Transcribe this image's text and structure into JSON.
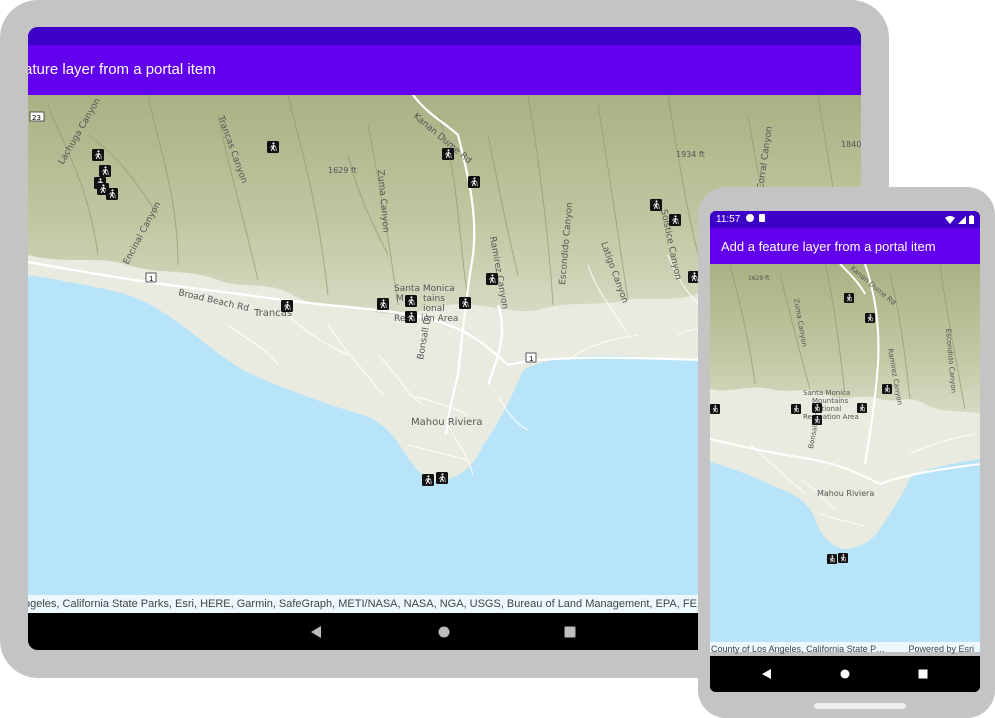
{
  "app": {
    "title": "Add a feature layer from a portal item",
    "tablet_title_visible": "ature layer from a portal item"
  },
  "status_bar": {
    "time": "11:57"
  },
  "map": {
    "labels": {
      "trancas": "Trancas",
      "mahou_riviera": "Mahou Riviera",
      "santa_monica_line1": "Santa Monica",
      "santa_monica_line2": "Mountains",
      "santa_monica_line3": "National",
      "santa_monica_line4": "Recreation Area",
      "tablet_sm_line2": "M",
      "tablet_sm_line2b": "tains",
      "tablet_sm_line3": "ional",
      "tablet_sm_line4": "Rec",
      "tablet_sm_line4b": "ion Area",
      "broad_beach_rd": "Broad Beach Rd",
      "bonsall_dr": "Bonsall Dr",
      "lachuga_canyon": "Lachuga Canyon",
      "encinal_canyon": "Encinal Canyon",
      "trancas_canyon": "Trancas Canyon",
      "zuma_canyon": "Zuma Canyon",
      "ramirez_canyon": "Ramirez Canyon",
      "escondido_canyon": "Escondido Canyon",
      "latigo_canyon": "Latigo Canyon",
      "corral_canyon": "Corral Canyon",
      "solstice_canyon": "Solstice Canyon",
      "kanan_dume_rd": "Kanan Dume Rd",
      "elevation_1": "1629 ft",
      "elevation_2": "1934 ft",
      "elevation_3": "1840 ft",
      "shield_1": "1",
      "shield_23": "23"
    },
    "poi_icon": "hiking-trailhead-icon",
    "colors": {
      "water": "#b8e4f9",
      "land": "#e9ebe0",
      "hills": "#b6bc94",
      "hills_dark": "#9aa57a",
      "roads": "#ffffff",
      "poi_bg": "#111111"
    }
  },
  "attribution": {
    "tablet": "ngeles, California State Parks, Esri, HERE, Garmin, SafeGraph, METI/NASA, NASA, NGA, USGS, Bureau of Land Management, EPA, FE",
    "phone": "County of Los Angeles, California State P…",
    "powered_by": "Powered by Esri"
  },
  "navigation": {
    "back_icon": "back-icon",
    "home_icon": "home-icon",
    "recents_icon": "recents-icon"
  },
  "theme": {
    "status_bar": "#3d00c9",
    "app_bar": "#6200ee",
    "device_frame": "#c4c4c4"
  }
}
